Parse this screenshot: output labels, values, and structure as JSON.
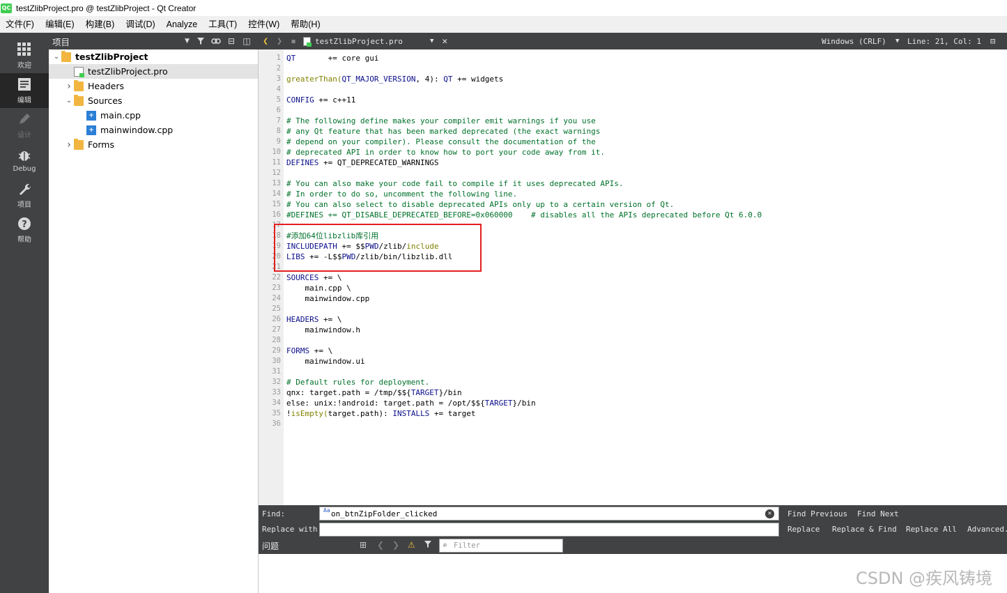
{
  "window": {
    "title": "testZlibProject.pro @ testZlibProject - Qt Creator",
    "logo_text": "QC"
  },
  "menu": [
    "文件(F)",
    "编辑(E)",
    "构建(B)",
    "调试(D)",
    "Analyze",
    "工具(T)",
    "控件(W)",
    "帮助(H)"
  ],
  "modes": [
    {
      "label": "欢迎",
      "icon": "grid-icon",
      "active": false,
      "enabled": true
    },
    {
      "label": "编辑",
      "icon": "document-icon",
      "active": true,
      "enabled": true
    },
    {
      "label": "设计",
      "icon": "pencil-icon",
      "active": false,
      "enabled": false
    },
    {
      "label": "Debug",
      "icon": "bug-icon",
      "active": false,
      "enabled": true
    },
    {
      "label": "项目",
      "icon": "wrench-icon",
      "active": false,
      "enabled": true
    },
    {
      "label": "帮助",
      "icon": "help-icon",
      "active": false,
      "enabled": true
    }
  ],
  "project_panel": {
    "title": "项目",
    "tree": [
      {
        "label": "testZlibProject",
        "depth": 0,
        "expanded": true,
        "type": "project",
        "bold": true
      },
      {
        "label": "testZlibProject.pro",
        "depth": 1,
        "type": "pro-file",
        "selected": true
      },
      {
        "label": "Headers",
        "depth": 1,
        "expanded": false,
        "type": "folder"
      },
      {
        "label": "Sources",
        "depth": 1,
        "expanded": true,
        "type": "folder"
      },
      {
        "label": "main.cpp",
        "depth": 2,
        "type": "cpp-file"
      },
      {
        "label": "mainwindow.cpp",
        "depth": 2,
        "type": "cpp-file"
      },
      {
        "label": "Forms",
        "depth": 1,
        "expanded": false,
        "type": "folder"
      }
    ]
  },
  "editor_toolbar": {
    "filename": "testZlibProject.pro",
    "encoding": "Windows (CRLF)",
    "position": "Line: 21, Col: 1"
  },
  "code_lines": [
    [
      {
        "t": "QT",
        "c": "kw"
      },
      {
        "t": "       += core gui",
        "c": ""
      }
    ],
    [],
    [
      {
        "t": "greaterThan(",
        "c": "var"
      },
      {
        "t": "QT_MAJOR_VERSION",
        "c": "kw"
      },
      {
        "t": ", 4): ",
        "c": ""
      },
      {
        "t": "QT",
        "c": "kw"
      },
      {
        "t": " += widgets",
        "c": ""
      }
    ],
    [],
    [
      {
        "t": "CONFIG",
        "c": "kw"
      },
      {
        "t": " += c++11",
        "c": ""
      }
    ],
    [],
    [
      {
        "t": "# The following define makes your compiler emit warnings if you use",
        "c": "cmt"
      }
    ],
    [
      {
        "t": "# any Qt feature that has been marked deprecated (the exact warnings",
        "c": "cmt"
      }
    ],
    [
      {
        "t": "# depend on your compiler). Please consult the documentation of the",
        "c": "cmt"
      }
    ],
    [
      {
        "t": "# deprecated API in order to know how to port your code away from it.",
        "c": "cmt"
      }
    ],
    [
      {
        "t": "DEFINES",
        "c": "kw"
      },
      {
        "t": " += QT_DEPRECATED_WARNINGS",
        "c": ""
      }
    ],
    [],
    [
      {
        "t": "# You can also make your code fail to compile if it uses deprecated APIs.",
        "c": "cmt"
      }
    ],
    [
      {
        "t": "# In order to do so, uncomment the following line.",
        "c": "cmt"
      }
    ],
    [
      {
        "t": "# You can also select to disable deprecated APIs only up to a certain version of Qt.",
        "c": "cmt"
      }
    ],
    [
      {
        "t": "#DEFINES += QT_DISABLE_DEPRECATED_BEFORE=0x060000    # disables all the APIs deprecated before Qt 6.0.0",
        "c": "cmt"
      }
    ],
    [],
    [
      {
        "t": "#添加64位libzlib库引用",
        "c": "cmt"
      }
    ],
    [
      {
        "t": "INCLUDEPATH",
        "c": "kw"
      },
      {
        "t": " += $$",
        "c": ""
      },
      {
        "t": "PWD",
        "c": "kw"
      },
      {
        "t": "/zlib/",
        "c": ""
      },
      {
        "t": "include",
        "c": "var"
      }
    ],
    [
      {
        "t": "LIBS",
        "c": "kw"
      },
      {
        "t": " += -L$$",
        "c": ""
      },
      {
        "t": "PWD",
        "c": "kw"
      },
      {
        "t": "/zlib/bin/libzlib.dll",
        "c": ""
      }
    ],
    [],
    [
      {
        "t": "SOURCES",
        "c": "kw"
      },
      {
        "t": " += \\",
        "c": ""
      }
    ],
    [
      {
        "t": "    main.cpp \\",
        "c": ""
      }
    ],
    [
      {
        "t": "    mainwindow.cpp",
        "c": ""
      }
    ],
    [],
    [
      {
        "t": "HEADERS",
        "c": "kw"
      },
      {
        "t": " += \\",
        "c": ""
      }
    ],
    [
      {
        "t": "    mainwindow.h",
        "c": ""
      }
    ],
    [],
    [
      {
        "t": "FORMS",
        "c": "kw"
      },
      {
        "t": " += \\",
        "c": ""
      }
    ],
    [
      {
        "t": "    mainwindow.ui",
        "c": ""
      }
    ],
    [],
    [
      {
        "t": "# Default rules for deployment.",
        "c": "cmt"
      }
    ],
    [
      {
        "t": "qnx: target.path = /tmp/$${",
        "c": ""
      },
      {
        "t": "TARGET",
        "c": "kw"
      },
      {
        "t": "}/bin",
        "c": ""
      }
    ],
    [
      {
        "t": "else: unix:!android: target.path = /opt/$${",
        "c": ""
      },
      {
        "t": "TARGET",
        "c": "kw"
      },
      {
        "t": "}/bin",
        "c": ""
      }
    ],
    [
      {
        "t": "!",
        "c": ""
      },
      {
        "t": "isEmpty(",
        "c": "var"
      },
      {
        "t": "target.path): ",
        "c": ""
      },
      {
        "t": "INSTALLS",
        "c": "kw"
      },
      {
        "t": " += target",
        "c": ""
      }
    ],
    []
  ],
  "find_bar": {
    "find_label": "Find:",
    "find_value": "on_btnZipFolder_clicked",
    "find_options_icon": "Aa",
    "replace_label": "Replace with:",
    "replace_value": "",
    "find_previous": "Find Previous",
    "find_next": "Find Next",
    "replace": "Replace",
    "replace_find": "Replace & Find",
    "replace_all": "Replace All",
    "advanced": "Advanced..."
  },
  "issues": {
    "title": "问题",
    "filter_placeholder": "Filter"
  },
  "watermark": "CSDN @疾风铸境"
}
